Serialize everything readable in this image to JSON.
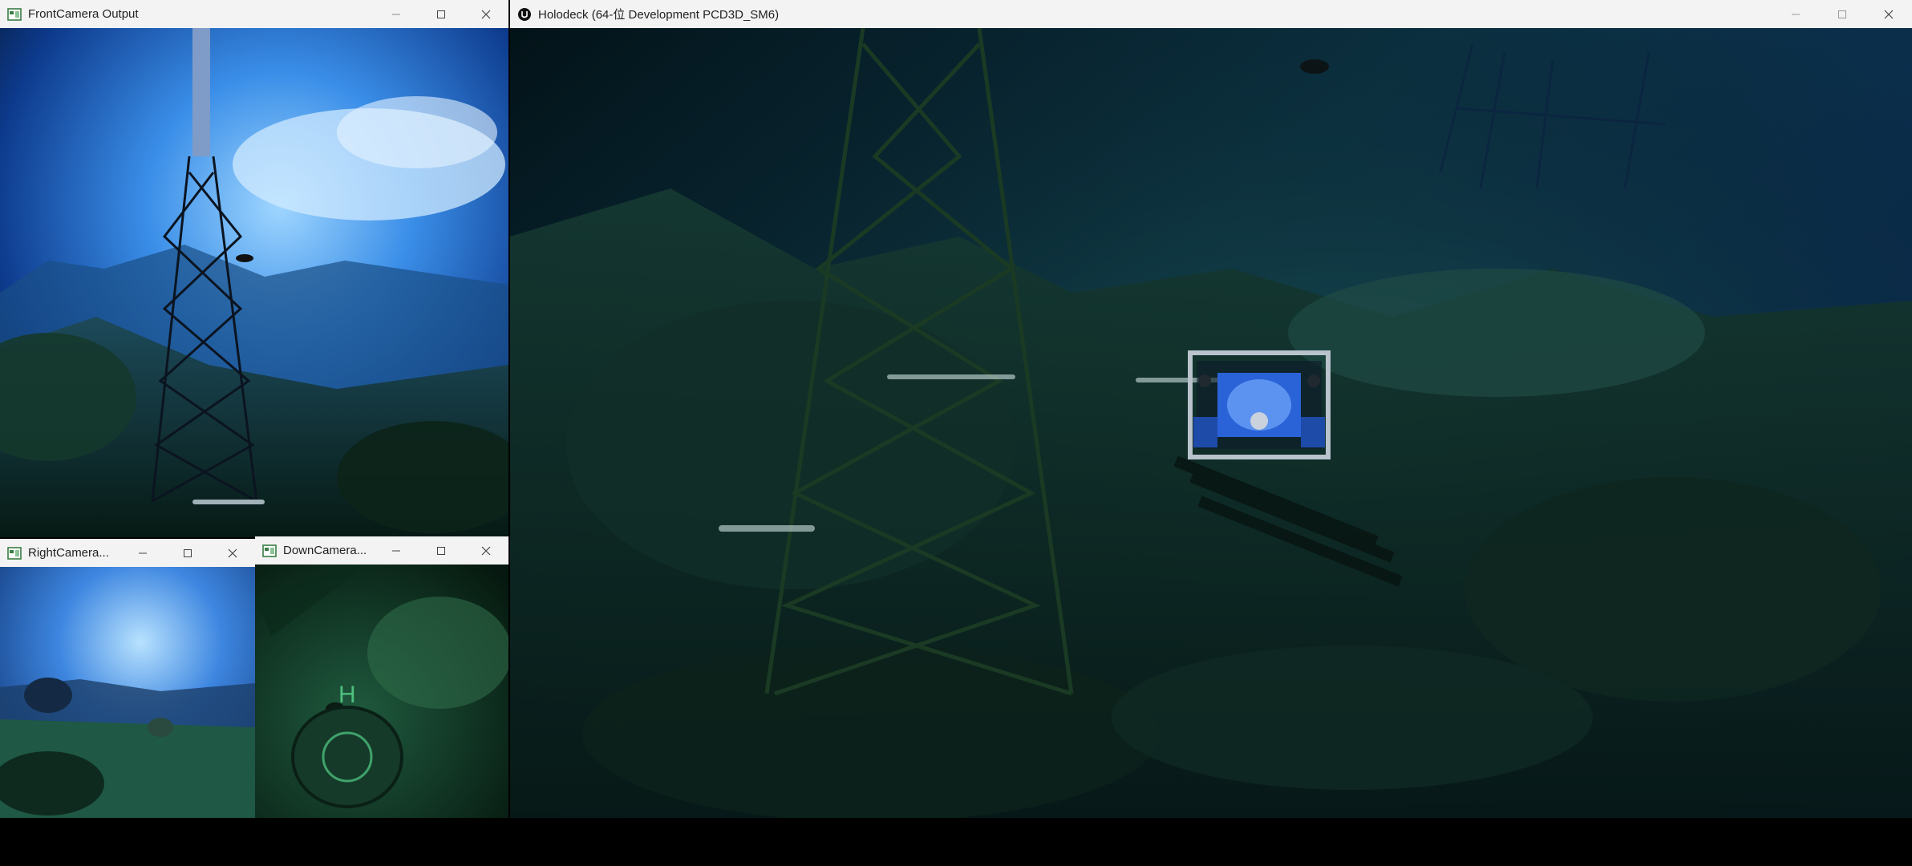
{
  "windows": {
    "front": {
      "title": "FrontCamera Output",
      "icon": "opencv-window-icon"
    },
    "right": {
      "title": "RightCamera...",
      "icon": "opencv-window-icon"
    },
    "down": {
      "title": "DownCamera...",
      "icon": "opencv-window-icon"
    },
    "holodeck": {
      "title": "Holodeck   (64-位 Development PCD3D_SM6)",
      "icon": "unreal-engine-icon"
    }
  },
  "scene": {
    "helipad_marker": "H",
    "colors": {
      "deep_water": "#0a2a3e",
      "bright_water": "#3a8ee8",
      "seafloor_green": "#1f4a36",
      "rov_frame": "#b9c3cc",
      "rov_blue": "#2a63d8"
    }
  }
}
